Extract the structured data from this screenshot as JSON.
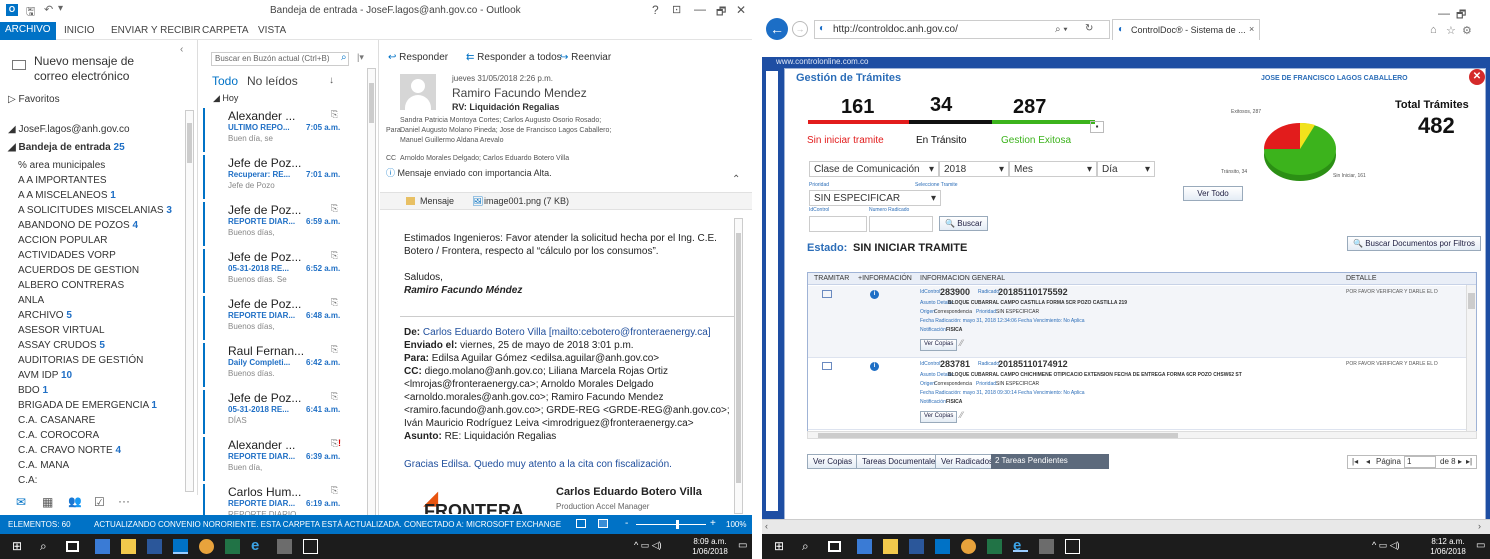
{
  "outlook": {
    "window_title": "Bandeja de entrada - JoseF.lagos@anh.gov.co - Outlook",
    "window_controls": [
      "?",
      "⊡",
      "—",
      "🗗",
      "✕"
    ],
    "ribbon_tabs": [
      "ARCHIVO",
      "INICIO",
      "ENVIAR Y RECIBIR",
      "CARPETA",
      "VISTA"
    ],
    "new_message": "Nuevo mensaje de correo electrónico",
    "favorites": "Favoritos",
    "account": "JoseF.lagos@anh.gov.co",
    "inbox_label": "Bandeja de entrada",
    "inbox_count": "25",
    "folders": [
      {
        "name": "% area municipales",
        "count": ""
      },
      {
        "name": "A A IMPORTANTES",
        "count": ""
      },
      {
        "name": "A A MISCELANEOS",
        "count": "1"
      },
      {
        "name": "A SOLICITUDES MISCELANIAS",
        "count": "3"
      },
      {
        "name": "ABANDONO DE POZOS",
        "count": "4"
      },
      {
        "name": "ACCION POPULAR",
        "count": ""
      },
      {
        "name": "ACTIVIDADES VORP",
        "count": ""
      },
      {
        "name": "ACUERDOS DE GESTION",
        "count": ""
      },
      {
        "name": "ALBERO CONTRERAS",
        "count": ""
      },
      {
        "name": "ANLA",
        "count": ""
      },
      {
        "name": "ARCHIVO",
        "count": "5"
      },
      {
        "name": "ASESOR VIRTUAL",
        "count": ""
      },
      {
        "name": "ASSAY CRUDOS",
        "count": "5"
      },
      {
        "name": "AUDITORIAS DE GESTIÓN",
        "count": ""
      },
      {
        "name": "AVM IDP",
        "count": "10"
      },
      {
        "name": "BDO",
        "count": "1"
      },
      {
        "name": "BRIGADA DE EMERGENCIA",
        "count": "1"
      },
      {
        "name": "C.A. CASANARE",
        "count": ""
      },
      {
        "name": "C.A. COROCORA",
        "count": ""
      },
      {
        "name": "C.A. CRAVO NORTE",
        "count": "4"
      },
      {
        "name": "C.A. MANA",
        "count": ""
      },
      {
        "name": "C.A:",
        "count": ""
      }
    ],
    "search_placeholder": "Buscar en Buzón actual (Ctrl+B)",
    "filter_all": "Todo",
    "filter_unread": "No leídos",
    "group_today": "Hoy",
    "messages": [
      {
        "sender": "Alexander ...",
        "subject": "ULTIMO REPO...",
        "time": "7:05 a.m.",
        "preview": "Buen día, se"
      },
      {
        "sender": "Jefe de Poz...",
        "subject": "Recuperar: RE...",
        "time": "7:01 a.m.",
        "preview": "Jefe de Pozo"
      },
      {
        "sender": "Jefe de Poz...",
        "subject": "REPORTE DIAR...",
        "time": "6:59 a.m.",
        "preview": "Buenos días,"
      },
      {
        "sender": "Jefe de Poz...",
        "subject": "05-31-2018 RE...",
        "time": "6:52 a.m.",
        "preview": "Buenos días. Se"
      },
      {
        "sender": "Jefe de Poz...",
        "subject": "REPORTE DIAR...",
        "time": "6:48 a.m.",
        "preview": "Buenos días,"
      },
      {
        "sender": "Raul Fernan...",
        "subject": "Daily Completi...",
        "time": "6:42 a.m.",
        "preview": "Buenos días."
      },
      {
        "sender": "Jefe de Poz...",
        "subject": "05-31-2018 RE...",
        "time": "6:41 a.m.",
        "preview": "DÍAS"
      },
      {
        "sender": "Alexander ...",
        "subject": "REPORTE DIAR...",
        "time": "6:39 a.m.",
        "preview": "Buen día,"
      },
      {
        "sender": "Carlos Hum...",
        "subject": "REPORTE DIAR...",
        "time": "6:19 a.m.",
        "preview": "REPORTE DIARIO"
      }
    ],
    "reading": {
      "reply": "Responder",
      "reply_all": "Responder a todos",
      "forward": "Reenviar",
      "date": "jueves 31/05/2018 2:26 p.m.",
      "from": "Ramiro Facundo Mendez",
      "subject": "RV: Liquidación Regalias",
      "para_label": "Para",
      "to_line1": "Sandra Patricia Montoya Cortes; Carlos Augusto Osorio Rosado;",
      "to_line2": "Daniel Augusto Molano Pineda; Jose de Francisco Lagos Caballero;",
      "to_line3": "Manuel Guillermo Aldana Arevalo",
      "cc_label": "CC",
      "cc": "Arnoldo Morales Delgado; Carlos Eduardo Botero Villa",
      "importance": "Mensaje enviado con importancia Alta.",
      "tab_message": "Mensaje",
      "attachment": "image001.png (7 KB)",
      "body1": "Estimados Ingenieros:  Favor atender la solicitud hecha por el Ing. C.E.",
      "body2": "Botero / Frontera, respecto al “cálculo por los consumos”.",
      "saludos": "Saludos,",
      "signature": "Ramiro Facundo Méndez",
      "q_from_label": "De:",
      "q_from": "Carlos Eduardo Botero Villa [mailto:cebotero@fronteraenergy.ca]",
      "q_sent_label": "Enviado el:",
      "q_sent": "viernes, 25 de mayo de 2018 3:01 p.m.",
      "q_to_label": "Para:",
      "q_to": "Edilsa Aguilar Gómez <edilsa.aguilar@anh.gov.co>",
      "q_cc_label": "CC:",
      "q_cc1": "diego.molano@anh.gov.co; Liliana Marcela Rojas Ortiz",
      "q_cc2": "<lmrojas@fronteraenergy.ca>; Arnoldo Morales Delgado",
      "q_cc3": "<arnoldo.morales@anh.gov.co>; Ramiro Facundo Mendez",
      "q_cc4": "<ramiro.facundo@anh.gov.co>; GRDE-REG <GRDE-REG@anh.gov.co>;",
      "q_cc5": "Iván Mauricio Rodríguez Leiva <imrodriguez@fronteraenergy.ca>",
      "q_subject_label": "Asunto:",
      "q_subject": "RE: Liquidación Regalias",
      "thanks": "Gracias Edilsa. Quedo muy atento a la cita con fiscalización.",
      "logo": "FRONTERA",
      "sig_name": "Carlos Eduardo Botero Villa",
      "sig_title": "Production Accel Manager"
    },
    "status": {
      "items": "ELEMENTOS: 60",
      "updating": "ACTUALIZANDO CONVENIO NORORIENTE.  ESTA CARPETA ESTÁ ACTUALIZADA.",
      "connected": "CONECTADO A: MICROSOFT EXCHANGE",
      "zoom": "100%"
    },
    "clock_time": "8:09 a.m.",
    "clock_date": "1/06/2018"
  },
  "ie": {
    "address": "http://controldoc.anh.gov.co/",
    "tab_title": "ControlDoc® - Sistema de ...",
    "site_strip": "www.controlonline.com.co",
    "clock_time": "8:12 a.m.",
    "clock_date": "1/06/2018"
  },
  "controldoc": {
    "title": "Gestión de Trámites",
    "user": "JOSE DE FRANCISCO LAGOS CABALLERO",
    "pending_count": "161",
    "transit_count": "34",
    "success_count": "287",
    "pending_label": "Sin iniciar tramite",
    "transit_label": "En Tránsito",
    "success_label": "Gestion Exitosa",
    "total_label": "Total Trámites",
    "total": "482",
    "pie_label_success": "Exitosos, 287",
    "pie_label_transit": "Tránsito, 34",
    "pie_label_pending": "Sin Iniciar, 161",
    "filter_class": "Clase de Comunicación",
    "filter_year": "2018",
    "filter_month": "Mes",
    "filter_day": "Día",
    "priority_label": "Prioridad",
    "select_label": "Seleccione Tramite",
    "priority_value": "SIN ESPECIFICAR",
    "view_all": "Ver Todo",
    "idcontrol_label": "IdControl",
    "radicado_label": "Numero Radicado",
    "search": "Buscar",
    "state_label": "Estado:",
    "state_value": "SIN INICIAR TRAMITE",
    "filter_search": "Buscar Documentos por Filtros",
    "col_tramitar": "TRAMITAR",
    "col_info": "+INFORMACIÓN",
    "col_general": "INFORMACION GENERAL",
    "col_detail": "DETALLE",
    "rows": [
      {
        "idcontrol_label": "IdControl:",
        "idcontrol": "283900",
        "radicado_label": "Radicado:",
        "radicado": "20185110175592",
        "asunto_label": "Asunto Detalle:",
        "asunto": "BLOQUE CUBARRAL CAMPO CASTILLA FORMA 5CR POZO CASTILLA 219",
        "origen_label": "Origen:",
        "origen": "Correspondencia",
        "prioridad_label": "Prioridad:",
        "prioridad": "SIN ESPECIFICAR",
        "fecha": "Fecha Radicación: mayo 31, 2018 12:34:06  Fecha Vencimiento: No Aplica",
        "notif_label": "Notificación:",
        "notif": "FISICA",
        "copies": "Ver Copias",
        "detail": "POR FAVOR VERIFICAR Y DARLE EL D"
      },
      {
        "idcontrol_label": "IdControl:",
        "idcontrol": "283781",
        "radicado_label": "Radicado:",
        "radicado": "20185110174912",
        "asunto_label": "Asunto Detalle:",
        "asunto": "BLOQUE CUBARRAL CAMPO CHICHIMENE OTIPICACIO EXTENSION FECHA DE ENTREGA FORMA 6CR POZO CHSW62 ST",
        "origen_label": "Origen:",
        "origen": "Correspondencia",
        "prioridad_label": "Prioridad:",
        "prioridad": "SIN ESPECIFICAR",
        "fecha": "Fecha Radicación: mayo 31, 2018 09:30:14  Fecha Vencimiento: No Aplica",
        "notif_label": "Notificación:",
        "notif": "FISICA",
        "copies": "Ver Copias",
        "detail": "POR FAVOR VERIFICAR Y DARLE EL D"
      }
    ],
    "btn_copies": "Ver Copias",
    "btn_tasks": "Tareas Documentales",
    "btn_radicados": "Ver Radicados",
    "pending_tasks": "2 Tareas Pendientes",
    "page_label": "Página",
    "page_value": "1",
    "page_of": "de 8",
    "colors": {
      "red": "#e21c1c",
      "black": "#111111",
      "green": "#3cb31c",
      "navy": "#1e4ea3",
      "outlook_blue": "#0072c6"
    }
  }
}
